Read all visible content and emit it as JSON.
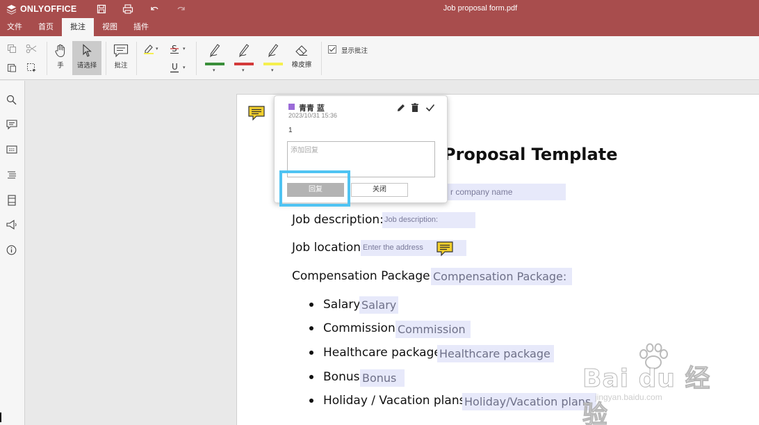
{
  "titlebar": {
    "app_name": "ONLYOFFICE",
    "document_title": "Job proposal form.pdf",
    "icons": [
      "save-icon",
      "print-icon",
      "undo-icon",
      "redo-icon"
    ]
  },
  "menu": {
    "tabs": [
      {
        "label": "文件",
        "active": false
      },
      {
        "label": "首页",
        "active": false
      },
      {
        "label": "批注",
        "active": true
      },
      {
        "label": "视图",
        "active": false
      },
      {
        "label": "插件",
        "active": false
      }
    ]
  },
  "toolbar": {
    "hand_label": "手",
    "select_label": "请选择",
    "comment_label": "批注",
    "eraser_label": "橡皮擦",
    "show_comments_label": "显示批注",
    "show_comments_checked": true,
    "pen_colors": [
      "#3a8f3a",
      "#d33a3a",
      "#f5ef4e"
    ],
    "highlight_color": "#f5ef4e"
  },
  "sidebar": {
    "icons": [
      "search-icon",
      "comments-icon",
      "chat-icon",
      "navigation-icon",
      "thumbnails-icon",
      "feedback-icon",
      "info-icon"
    ]
  },
  "document": {
    "heading": "Proposal Template",
    "company_placeholder": "r company name",
    "rows": [
      {
        "label": "Job description:",
        "field": "Job description:"
      },
      {
        "label": "Job location:",
        "field": "Enter the address"
      },
      {
        "label": "Compensation Package:",
        "field": "Compensation Package:"
      }
    ],
    "bullets": [
      {
        "label": "Salary",
        "field": "Salary"
      },
      {
        "label": "Commission",
        "field": "Commission"
      },
      {
        "label": "Healthcare package",
        "field": "Healthcare package"
      },
      {
        "label": "Bonus",
        "field": "Bonus"
      },
      {
        "label": "Holiday / Vacation plans",
        "field": "Holiday/Vacation plans"
      }
    ]
  },
  "comment_popup": {
    "user": "青青 蓝",
    "user_color": "#9b6bd8",
    "timestamp": "2023/10/31 15:36",
    "text": "1",
    "reply_placeholder": "添加回复",
    "reply_button": "回复",
    "close_button": "关闭"
  },
  "watermark": {
    "main": "Bai du 经验",
    "sub": "jingyan.baidu.com"
  },
  "colors": {
    "brand": "#a84d4d",
    "field_bg": "#e7e9fa",
    "highlight_outline": "#4fc3f2",
    "note_icon": "#f2cf2d"
  }
}
